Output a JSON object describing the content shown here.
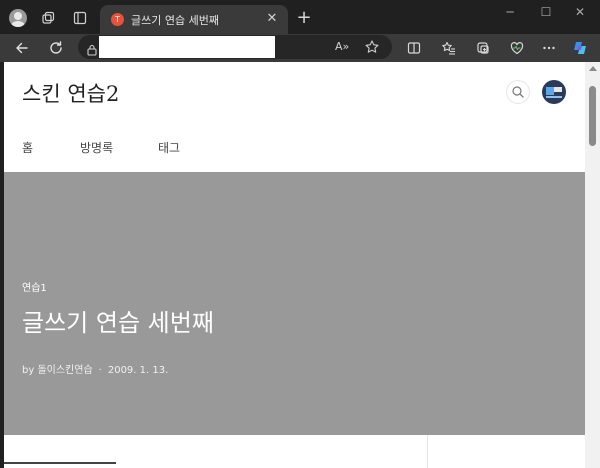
{
  "browser": {
    "tab": {
      "title": "글쓰기 연습 세번째",
      "favicon_letter": "T"
    },
    "icons": {
      "profile": "profile-icon",
      "workspaces": "workspaces-icon",
      "tab_actions": "tab-actions-icon",
      "back": "back-icon",
      "refresh": "refresh-icon",
      "lock": "lock-icon",
      "read_aloud": "read-aloud-icon",
      "favorite": "star-icon",
      "split_screen": "split-screen-icon",
      "favorites": "favorites-icon",
      "collections": "collections-icon",
      "browser_essentials": "heart-pulse-icon",
      "more": "more-icon",
      "copilot": "copilot-icon"
    },
    "read_aloud_label": "A»"
  },
  "blog": {
    "title": "스킨 연습2",
    "nav": [
      {
        "label": "홈"
      },
      {
        "label": "방명록"
      },
      {
        "label": "태그"
      }
    ]
  },
  "hero": {
    "category": "연습1",
    "title": "글쓰기 연습 세번째",
    "author": "by 돌이스킨연습",
    "separator": "·",
    "date": "2009. 1. 13."
  },
  "colors": {
    "chrome_dark": "#202020",
    "toolbar": "#3a3a3a",
    "hero_bg": "#999999",
    "favicon": "#e8523a",
    "copilot": "#3b8eea"
  }
}
